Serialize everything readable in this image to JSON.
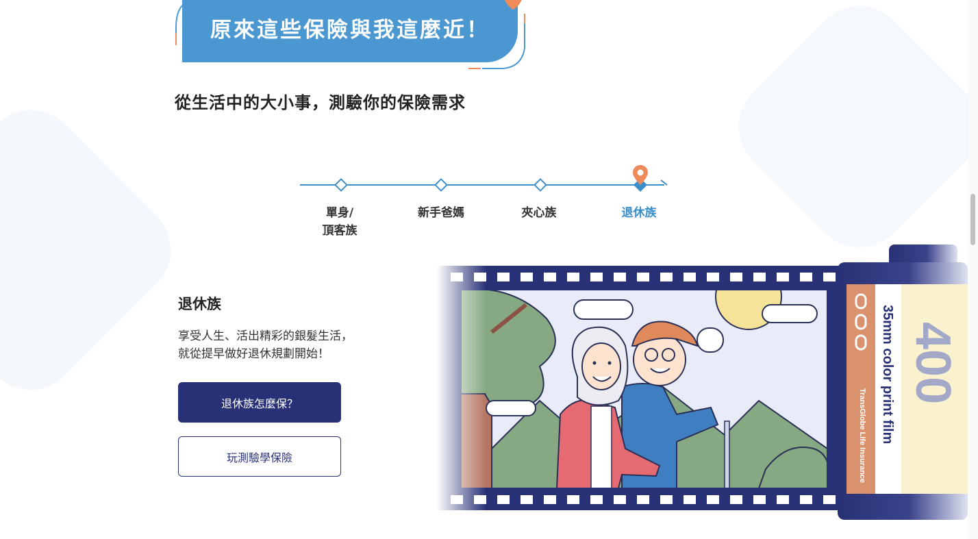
{
  "banner": {
    "title": "原來這些保險與我這麼近！"
  },
  "subtitle": "從生活中的大小事，測驗你的保險需求",
  "timeline": {
    "items": [
      {
        "label": "單身/\n頂客族"
      },
      {
        "label": "新手爸媽"
      },
      {
        "label": "夾心族"
      },
      {
        "label": "退休族"
      }
    ],
    "active_index": 3
  },
  "section": {
    "title": "退休族",
    "desc_line1": "享受人生、活出精彩的銀髮生活，",
    "desc_line2": "就從提早做好退休規劃開始！",
    "primary_button": "退休族怎麼保？",
    "secondary_button": "玩測驗學保險"
  },
  "film": {
    "brand": "35mm color print film",
    "company": "TransGlobe Life Insurance",
    "speed": "400"
  },
  "colors": {
    "accent_blue": "#4a97d1",
    "navy": "#293176",
    "orange": "#ef8a5a"
  }
}
